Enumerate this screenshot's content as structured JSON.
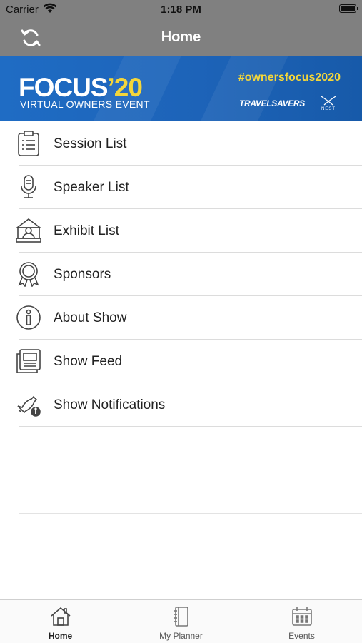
{
  "status_bar": {
    "carrier": "Carrier",
    "time": "1:18 PM"
  },
  "nav": {
    "title": "Home",
    "refresh_icon": "refresh-icon"
  },
  "banner": {
    "logo_text": "FOCUS",
    "logo_year": "’20",
    "subtitle": "VIRTUAL OWNERS EVENT",
    "hashtag": "#ownersfocus2020",
    "brand_travelsavers": "TRAVELSAVERS",
    "brand_nest": "NEST",
    "colors": {
      "background": "#1f6cc4",
      "accent": "#f4d63a"
    }
  },
  "menu": {
    "items": [
      {
        "label": "Session List",
        "icon": "clipboard-list-icon"
      },
      {
        "label": "Speaker List",
        "icon": "microphone-icon"
      },
      {
        "label": "Exhibit List",
        "icon": "exhibit-booth-icon"
      },
      {
        "label": "Sponsors",
        "icon": "award-ribbon-icon"
      },
      {
        "label": "About Show",
        "icon": "info-icon"
      },
      {
        "label": "Show Feed",
        "icon": "newspaper-icon"
      },
      {
        "label": "Show Notifications",
        "icon": "bell-info-icon"
      }
    ]
  },
  "tabbar": {
    "tabs": [
      {
        "label": "Home",
        "icon": "home-icon",
        "active": true
      },
      {
        "label": "My Planner",
        "icon": "notebook-icon",
        "active": false
      },
      {
        "label": "Events",
        "icon": "calendar-icon",
        "active": false
      }
    ]
  }
}
